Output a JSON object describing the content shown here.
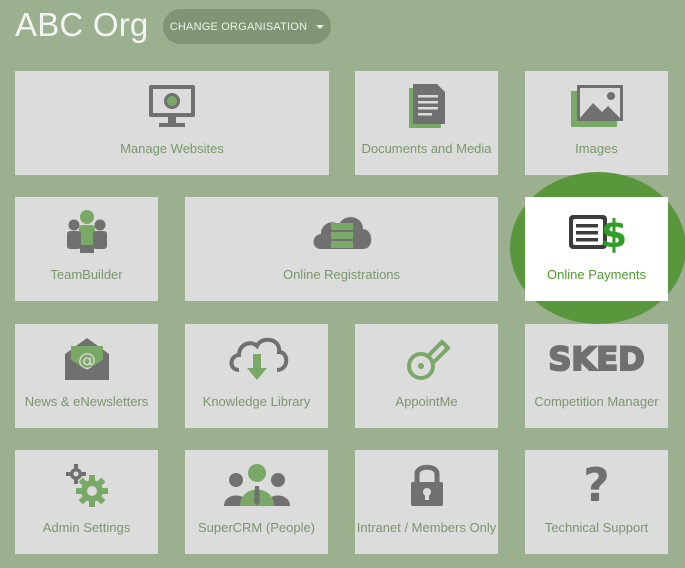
{
  "header": {
    "org_name": "ABC Org",
    "change_org_label": "CHANGE ORGANISATION"
  },
  "tiles": {
    "manage_websites": "Manage Websites",
    "documents_media": "Documents and Media",
    "images": "Images",
    "teambuilder": "TeamBuilder",
    "online_registrations": "Online Registrations",
    "online_payments": "Online Payments",
    "news_enewsletters": "News & eNewsletters",
    "knowledge_library": "Knowledge Library",
    "appointme": "AppointMe",
    "competition_manager": "Competition Manager",
    "admin_settings": "Admin Settings",
    "supercrm": "SuperCRM (People)",
    "intranet": "Intranet / Members Only",
    "technical_support": "Technical Support"
  },
  "sked_logo_text": "SKED",
  "help_glyph": "?",
  "colors": {
    "background": "#9bb08e",
    "tile": "#dcdcdc",
    "label": "#78986b",
    "icon_gray": "#707070",
    "icon_green": "#7aa867",
    "highlight_circle": "#5a963c",
    "highlight_label": "#4f9c2d"
  }
}
